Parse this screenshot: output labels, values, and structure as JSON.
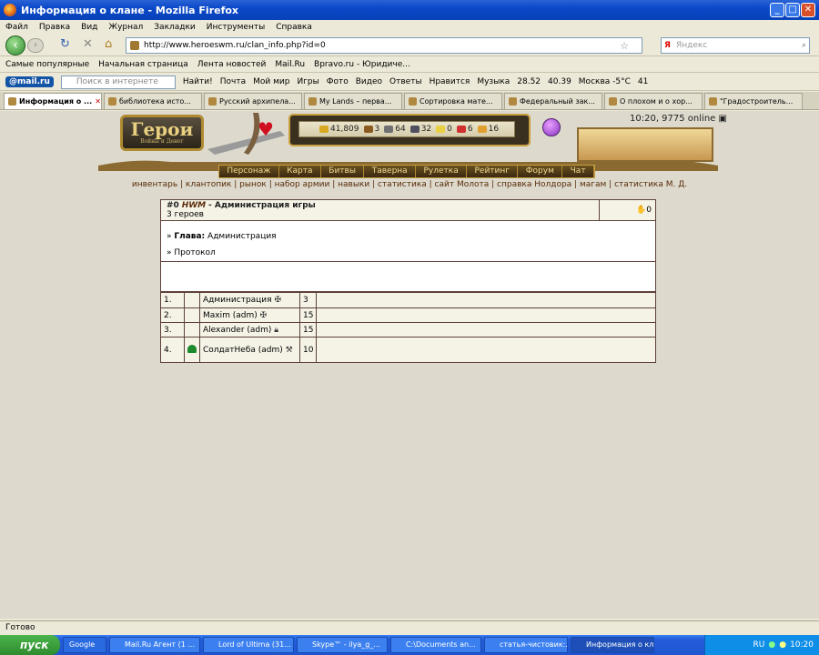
{
  "window": {
    "title": "Информация о клане - Mozilla Firefox"
  },
  "menu": [
    "Файл",
    "Правка",
    "Вид",
    "Журнал",
    "Закладки",
    "Инструменты",
    "Справка"
  ],
  "nav": {
    "url": "http://www.heroeswm.ru/clan_info.php?id=0",
    "search_placeholder": "Яндекс"
  },
  "bookmarks": [
    "Самые популярные",
    "Начальная страница",
    "Лента новостей",
    "Mail.Ru",
    "Bpravo.ru - Юридиче..."
  ],
  "mailbar": {
    "logo": "@mail.ru",
    "search_placeholder": "Поиск в интернете",
    "find": "Найти!",
    "items": [
      "Почта",
      "Мой мир",
      "Игры",
      "Фото",
      "Видео",
      "Ответы",
      "Нравится",
      "Музыка",
      "28.52",
      "40.39",
      "Москва -5°C",
      "41"
    ]
  },
  "tabs": [
    "Информация о ...",
    "библиотека исто...",
    "Русский архипела...",
    "My Lands – перва...",
    "Сортировка мате...",
    "Федеральный зак...",
    "О плохом и о хор...",
    "\"Градостроитель..."
  ],
  "game": {
    "online": "10:20, 9775 online",
    "logo": "Герои",
    "logo_sub": "Войны и Денег",
    "resources": [
      "41,809",
      "3",
      "64",
      "32",
      "0",
      "6",
      "16"
    ],
    "menu": [
      "Персонаж",
      "Карта",
      "Битвы",
      "Таверна",
      "Рулетка",
      "Рейтинг",
      "Форум",
      "Чат"
    ],
    "links": [
      "инвентарь",
      "клантопик",
      "рынок",
      "набор армии",
      "навыки",
      "статистика",
      "сайт Молота",
      "справка Нолдора",
      "магам",
      "статистика М. Д."
    ]
  },
  "clan": {
    "id": "#0",
    "abbr": "HWM",
    "name": "- Администрация игры",
    "heroes": "3 героев",
    "power": "0",
    "head_label": "Глава:",
    "head_value": "Администрация",
    "protocol": "Протокол",
    "members": [
      {
        "n": "1.",
        "name": "Администрация",
        "lvl": "3"
      },
      {
        "n": "2.",
        "name": "Maxim (adm)",
        "lvl": "15"
      },
      {
        "n": "3.",
        "name": "Alexander (adm)",
        "lvl": "15"
      },
      {
        "n": "4.",
        "name": "СолдатНеба (adm)",
        "lvl": "10"
      }
    ]
  },
  "status": "Готово",
  "taskbar": {
    "start": "пуск",
    "items": [
      "Google",
      "Mail.Ru Агент (1 ...",
      "Lord of Ultima (31...",
      "Skype™ - ilya_g_...",
      "C:\\Documents an...",
      "статья-чистовик:...",
      "Информация о кл..."
    ],
    "lang": "RU",
    "time": "10:20"
  }
}
